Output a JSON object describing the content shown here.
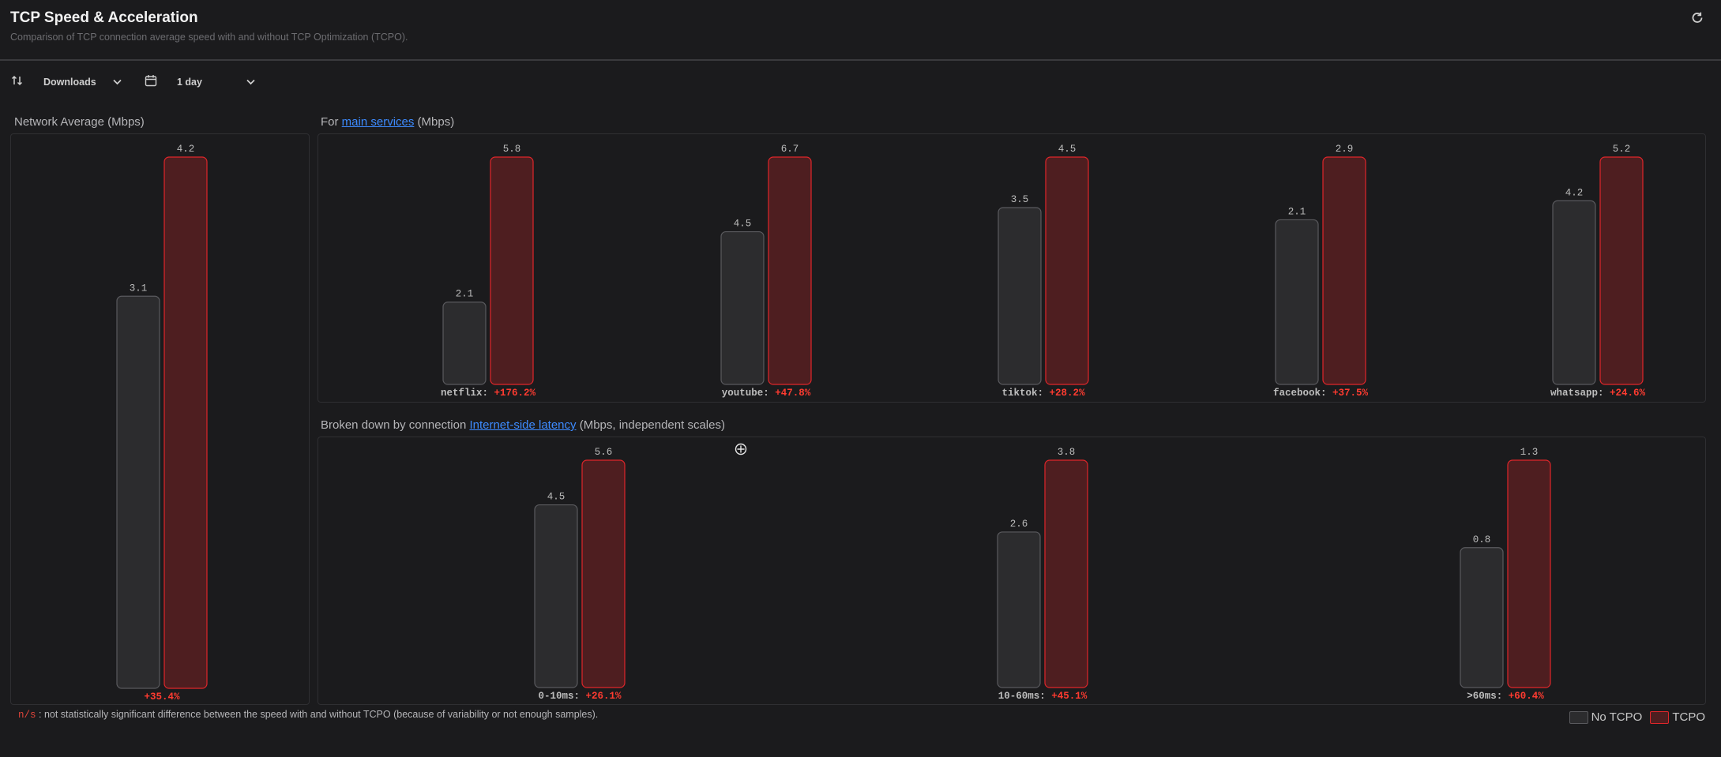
{
  "header": {
    "title": "TCP Speed & Acceleration",
    "subtitle": "Comparison of TCP connection average speed with and without TCP Optimization (TCPO)."
  },
  "toolbar": {
    "direction_value": "Downloads",
    "period_value": "1 day"
  },
  "panels": {
    "network": {
      "title": "Network Average (Mbps)"
    },
    "services": {
      "prefix": "For ",
      "link": "main services",
      "suffix": " (Mbps)"
    },
    "latency": {
      "prefix": "Broken down by connection ",
      "link": "Internet-side latency",
      "suffix": " (Mbps, independent scales)"
    }
  },
  "footnote": {
    "ns": "n/s",
    "text": ": not statistically significant difference between the speed with and without TCPO (because of variability or not enough samples)."
  },
  "legend": {
    "no_tcpo": "No TCPO",
    "tcpo": "TCPO"
  },
  "colors": {
    "no_tcpo_fill": "#2c2c2e",
    "no_tcpo_stroke": "#5a5a5e",
    "tcpo_fill": "#4e1e20",
    "tcpo_stroke": "#e0262a",
    "gain": "#ff3b30",
    "link": "#3d8bff"
  },
  "chart_data": [
    {
      "type": "bar",
      "id": "network",
      "categories": [
        ""
      ],
      "series": [
        {
          "name": "No TCPO",
          "values": [
            3.1
          ]
        },
        {
          "name": "TCPO",
          "values": [
            4.2
          ]
        }
      ],
      "gains": [
        "+35.4%"
      ],
      "scale": "independent"
    },
    {
      "type": "bar",
      "id": "services",
      "categories": [
        "netflix",
        "youtube",
        "tiktok",
        "facebook",
        "whatsapp"
      ],
      "series": [
        {
          "name": "No TCPO",
          "values": [
            2.1,
            4.5,
            3.5,
            2.1,
            4.2
          ]
        },
        {
          "name": "TCPO",
          "values": [
            5.8,
            6.7,
            4.5,
            2.9,
            5.2
          ]
        }
      ],
      "gains": [
        "+176.2%",
        "+47.8%",
        "+28.2%",
        "+37.5%",
        "+24.6%"
      ],
      "scale": "independent"
    },
    {
      "type": "bar",
      "id": "latency",
      "categories": [
        "0-10ms",
        "10-60ms",
        ">60ms"
      ],
      "series": [
        {
          "name": "No TCPO",
          "values": [
            4.5,
            2.6,
            0.8
          ]
        },
        {
          "name": "TCPO",
          "values": [
            5.6,
            3.8,
            1.3
          ]
        }
      ],
      "gains": [
        "+26.1%",
        "+45.1%",
        "+60.4%"
      ],
      "scale": "independent"
    }
  ]
}
